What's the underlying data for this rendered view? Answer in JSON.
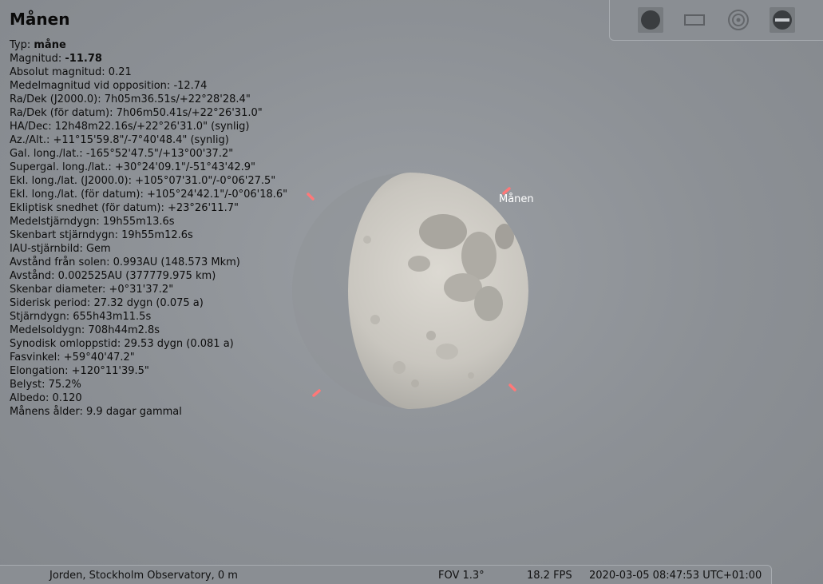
{
  "object": {
    "title": "Månen",
    "sky_label": "Månen",
    "info": [
      {
        "label": "Typ: ",
        "value": "måne",
        "bold": true
      },
      {
        "label": "Magnitud: ",
        "value": "-11.78",
        "bold": true
      },
      {
        "label": "Absolut magnitud: ",
        "value": "0.21"
      },
      {
        "label": "Medelmagnitud vid opposition: ",
        "value": "-12.74"
      },
      {
        "label": "Ra/Dek (J2000.0): ",
        "value": "7h05m36.51s/+22°28'28.4\""
      },
      {
        "label": "Ra/Dek (för datum): ",
        "value": "7h06m50.41s/+22°26'31.0\""
      },
      {
        "label": "HA/Dec: ",
        "value": "12h48m22.16s/+22°26'31.0\" (synlig)"
      },
      {
        "label": "Az./Alt.: ",
        "value": "+11°15'59.8\"/-7°40'48.4\" (synlig)"
      },
      {
        "label": "Gal. long./lat.: ",
        "value": "-165°52'47.5\"/+13°00'37.2\""
      },
      {
        "label": "Supergal. long./lat.: ",
        "value": "+30°24'09.1\"/-51°43'42.9\""
      },
      {
        "label": "Ekl. long./lat. (J2000.0): ",
        "value": "+105°07'31.0\"/-0°06'27.5\""
      },
      {
        "label": "Ekl. long./lat. (för datum): ",
        "value": "+105°24'42.1\"/-0°06'18.6\""
      },
      {
        "label": "Ekliptisk snedhet (för datum): ",
        "value": "+23°26'11.7\""
      },
      {
        "label": "Medelstjärndygn: ",
        "value": "19h55m13.6s"
      },
      {
        "label": "Skenbart stjärndygn: ",
        "value": "19h55m12.6s"
      },
      {
        "label": "IAU-stjärnbild: ",
        "value": "Gem"
      },
      {
        "label": "Avstånd från solen: ",
        "value": "0.993AU (148.573 Mkm)"
      },
      {
        "label": "Avstånd: ",
        "value": "0.002525AU (377779.975 km)"
      },
      {
        "label": "Skenbar diameter: ",
        "value": "+0°31'37.2\""
      },
      {
        "label": "Siderisk period: ",
        "value": "27.32 dygn (0.075 a)"
      },
      {
        "label": "Stjärndygn: ",
        "value": "655h43m11.5s"
      },
      {
        "label": "Medelsoldygn: ",
        "value": "708h44m2.8s"
      },
      {
        "label": "Synodisk omloppstid: ",
        "value": "29.53 dygn (0.081 a)"
      },
      {
        "label": "Fasvinkel: ",
        "value": "+59°40'47.2\""
      },
      {
        "label": "Elongation: ",
        "value": "+120°11'39.5\""
      },
      {
        "label": "Belyst: ",
        "value": "75.2%"
      },
      {
        "label": "Albedo: ",
        "value": "0.120"
      },
      {
        "label": "Månens ålder: ",
        "value": "9.9 dagar gammal"
      }
    ],
    "illuminated_fraction": 0.752
  },
  "toolbar": {
    "buttons": [
      {
        "name": "circle-icon"
      },
      {
        "name": "rectangle-icon"
      },
      {
        "name": "target-icon"
      },
      {
        "name": "remove-icon"
      }
    ]
  },
  "statusbar": {
    "location": "Jorden, Stockholm Observatory, 0 m",
    "fov": "FOV 1.3°",
    "fps": "18.2 FPS",
    "datetime": "2020-03-05 08:47:53 UTC+01:00"
  },
  "colors": {
    "sky": "#8c9095",
    "selection_marker": "#ff7070",
    "label": "#ffffff"
  }
}
